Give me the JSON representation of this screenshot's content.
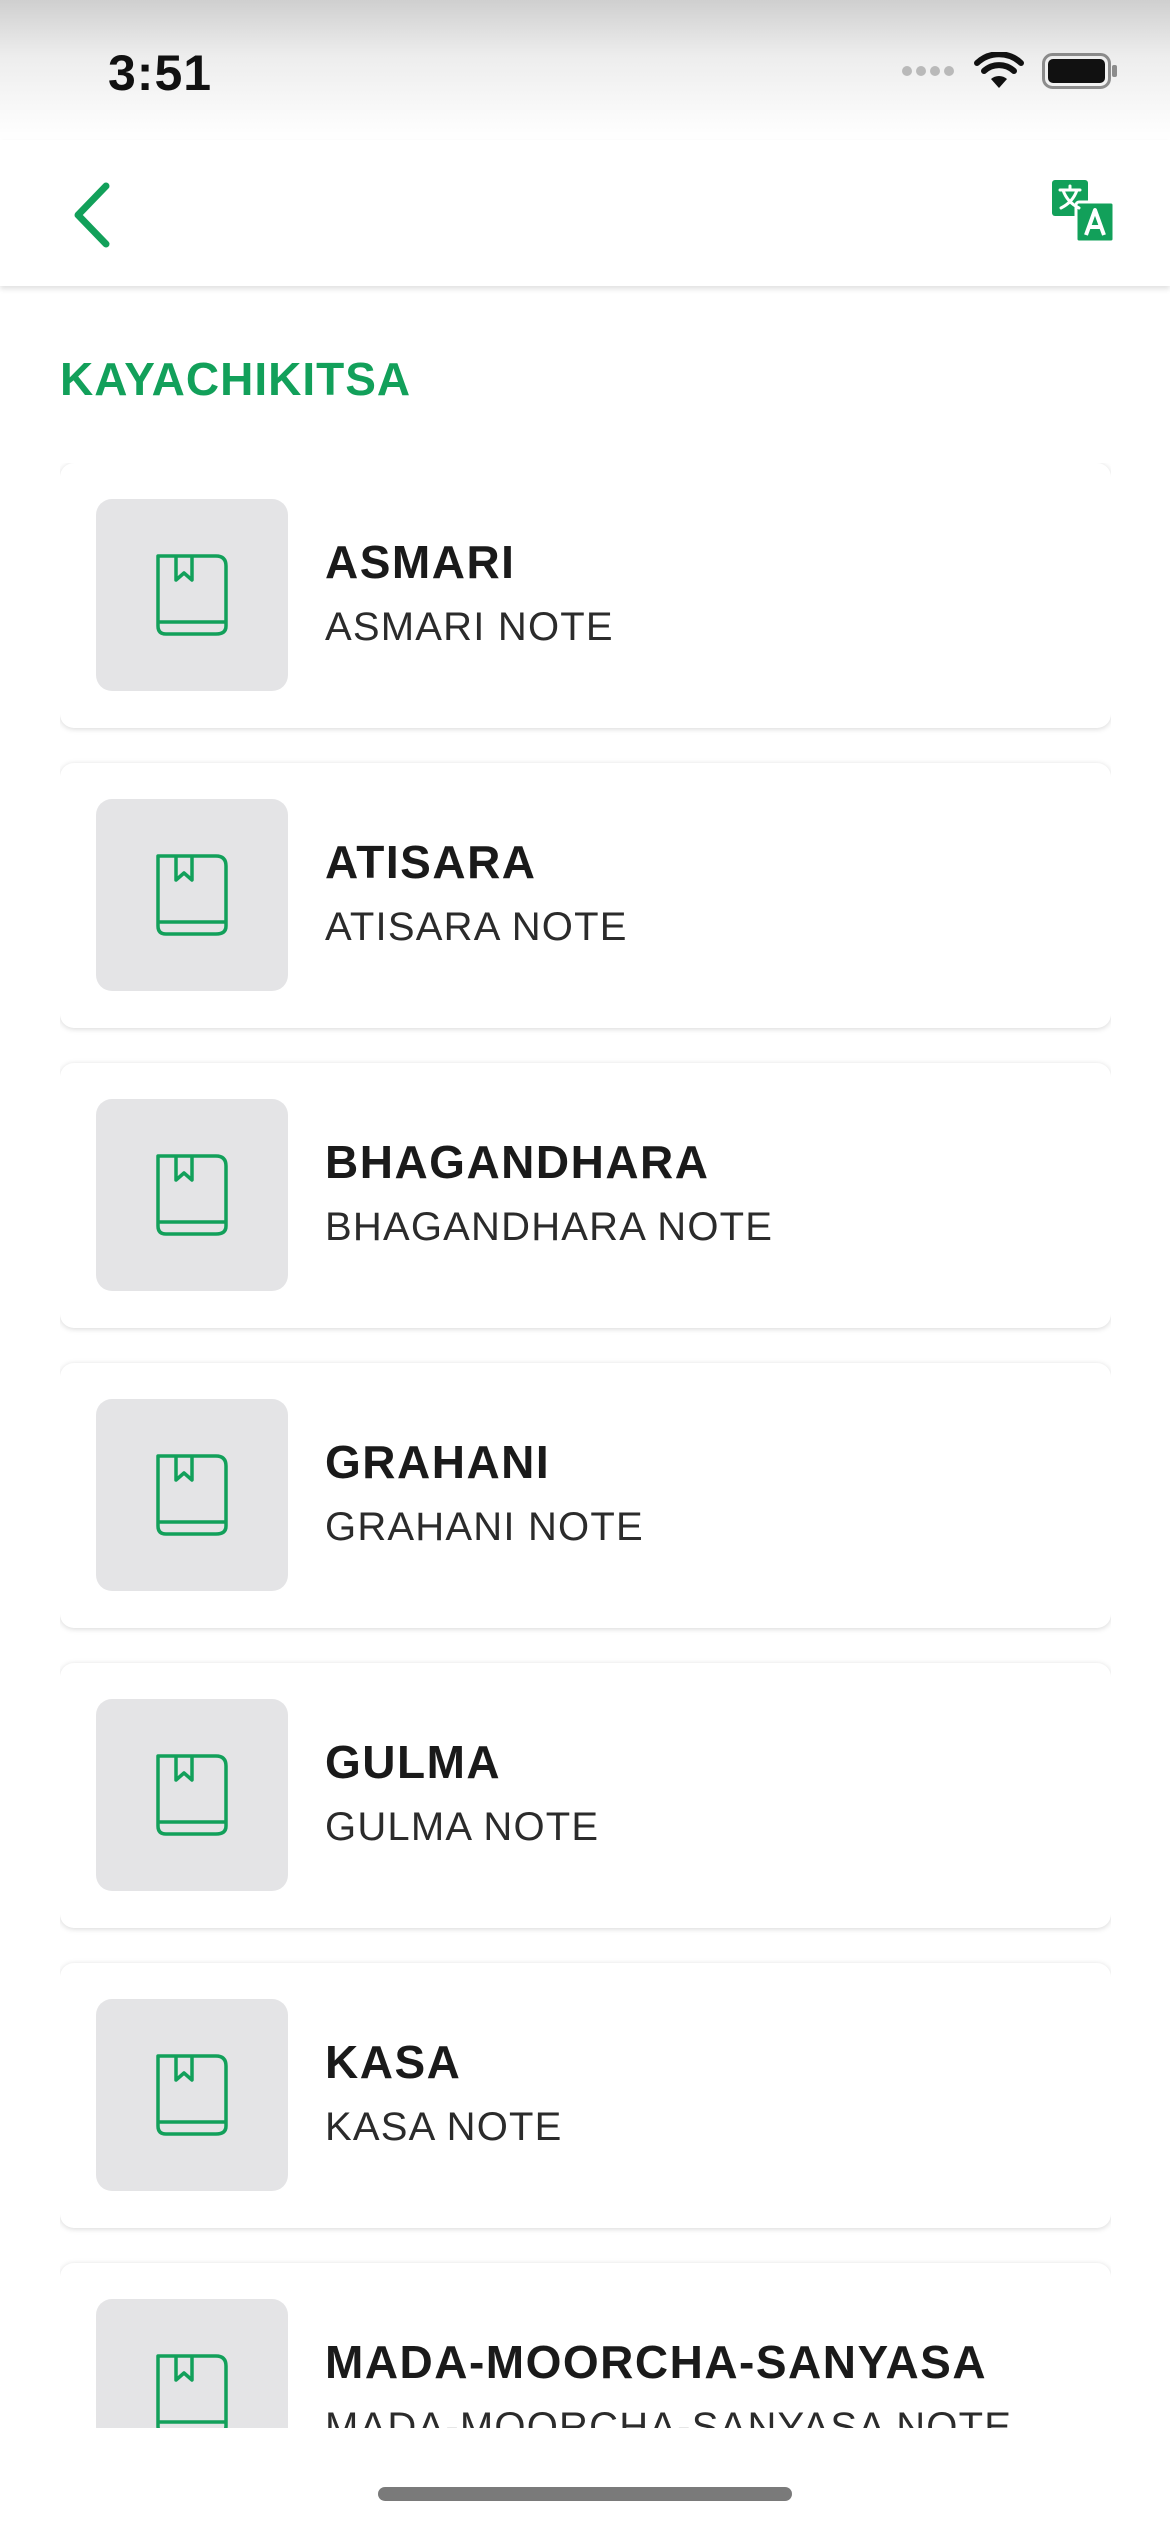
{
  "status_bar": {
    "time": "3:51"
  },
  "nav": {
    "back_icon": "chevron-left-icon",
    "translate_icon": "translate-icon",
    "accent_color": "#12a05a"
  },
  "section": {
    "title": "KAYACHIKITSA"
  },
  "items": [
    {
      "title": "ASMARI",
      "subtitle": "ASMARI NOTE",
      "icon": "book-icon"
    },
    {
      "title": "ATISARA",
      "subtitle": "ATISARA NOTE",
      "icon": "book-icon"
    },
    {
      "title": "BHAGANDHARA",
      "subtitle": "BHAGANDHARA NOTE",
      "icon": "book-icon"
    },
    {
      "title": "GRAHANI",
      "subtitle": "GRAHANI NOTE",
      "icon": "book-icon"
    },
    {
      "title": "GULMA",
      "subtitle": "GULMA NOTE",
      "icon": "book-icon"
    },
    {
      "title": "KASA",
      "subtitle": "KASA NOTE",
      "icon": "book-icon"
    },
    {
      "title": "MADA-MOORCHA-SANYASA",
      "subtitle": "MADA-MOORCHA-SANYASA NOTE",
      "icon": "book-icon"
    }
  ]
}
